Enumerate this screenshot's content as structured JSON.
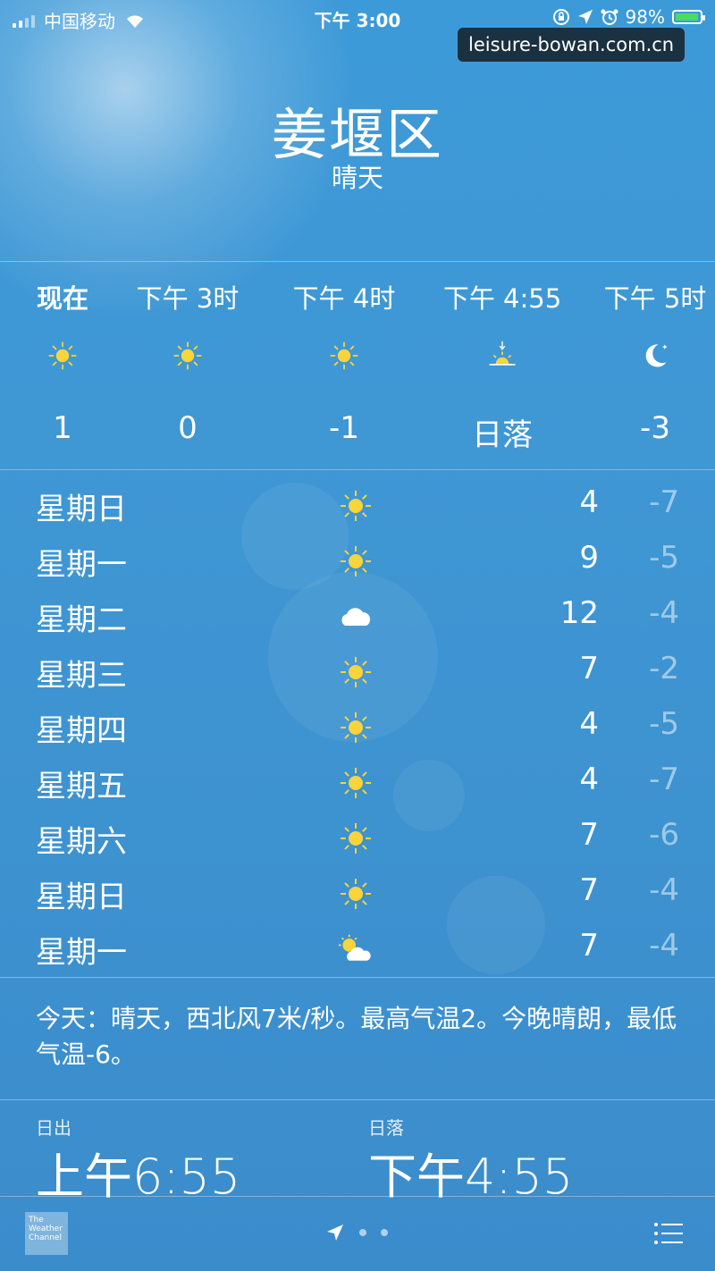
{
  "status_bar": {
    "carrier": "中国移动",
    "time": "下午 3:00",
    "battery": "98%",
    "battery_level": 0.98,
    "icons": [
      "signal-icon",
      "wifi-icon",
      "lock-rotation-icon",
      "location-icon",
      "alarm-icon",
      "battery-icon"
    ]
  },
  "watermark": "leisure-bowan.com.cn",
  "location": {
    "city": "姜堰区",
    "condition": "晴天"
  },
  "hourly": [
    {
      "time": "现在",
      "icon": "sun-icon",
      "value": "1"
    },
    {
      "time": "下午 3时",
      "icon": "sun-icon",
      "value": "0"
    },
    {
      "time": "下午 4时",
      "icon": "sun-icon",
      "value": "-1"
    },
    {
      "time": "下午 4:55",
      "icon": "sunset-icon",
      "value": "日落"
    },
    {
      "time": "下午 5时",
      "icon": "moon-icon",
      "value": "-3"
    }
  ],
  "daily": [
    {
      "day": "星期日",
      "icon": "sun-icon",
      "high": "4",
      "low": "-7"
    },
    {
      "day": "星期一",
      "icon": "sun-icon",
      "high": "9",
      "low": "-5"
    },
    {
      "day": "星期二",
      "icon": "cloud-icon",
      "high": "12",
      "low": "-4"
    },
    {
      "day": "星期三",
      "icon": "sun-icon",
      "high": "7",
      "low": "-2"
    },
    {
      "day": "星期四",
      "icon": "sun-icon",
      "high": "4",
      "low": "-5"
    },
    {
      "day": "星期五",
      "icon": "sun-icon",
      "high": "4",
      "low": "-7"
    },
    {
      "day": "星期六",
      "icon": "sun-icon",
      "high": "7",
      "low": "-6"
    },
    {
      "day": "星期日",
      "icon": "sun-icon",
      "high": "7",
      "low": "-4"
    },
    {
      "day": "星期一",
      "icon": "partly-cloudy-icon",
      "high": "7",
      "low": "-4"
    }
  ],
  "summary": "今天：晴天，西北风7米/秒。最高气温2。今晚晴朗，最低气温-6。",
  "sun_times": {
    "sunrise_label": "日出",
    "sunrise": "上午6:55",
    "sunset_label": "日落",
    "sunset": "下午4:55"
  },
  "bottom_bar": {
    "logo_text": "The Weather Channel",
    "page_dots": 2
  },
  "colors": {
    "background": "#3f97d4",
    "sun": "#f9d43a",
    "low_temp": "#9fc9eb"
  }
}
